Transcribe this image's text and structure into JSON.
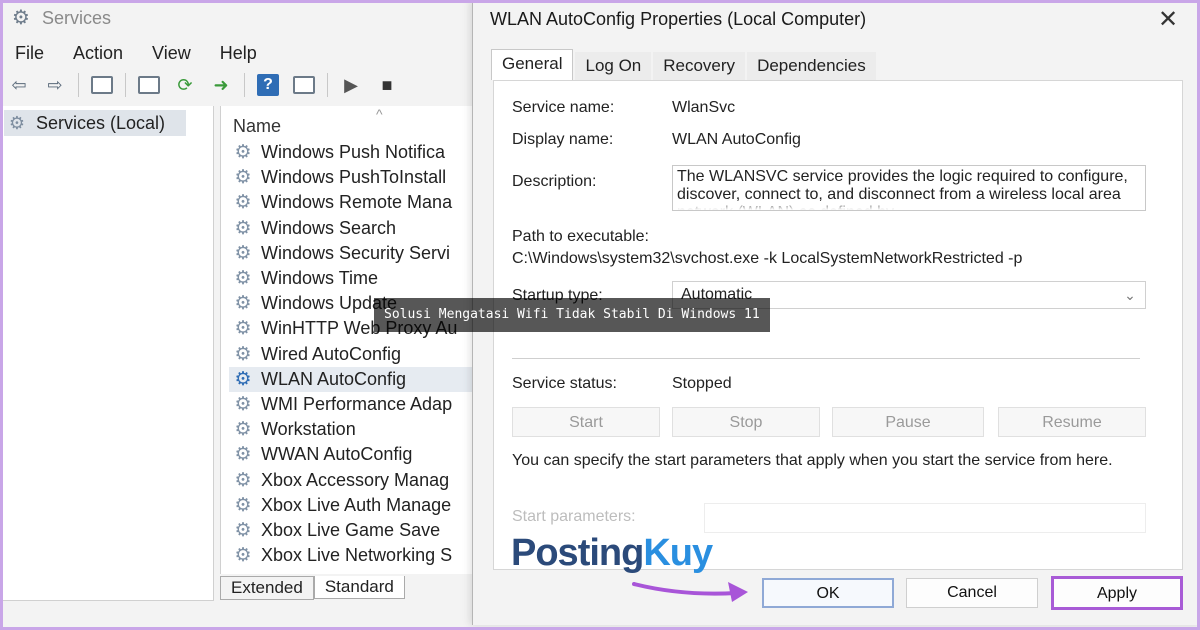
{
  "services_window": {
    "title": "Services",
    "menu": [
      "File",
      "Action",
      "View",
      "Help"
    ],
    "tree_item": "Services (Local)",
    "column_header": "Name",
    "rows": [
      "Windows Push Notifica",
      "Windows PushToInstall",
      "Windows Remote Mana",
      "Windows Search",
      "Windows Security Servi",
      "Windows Time",
      "Windows Update",
      "WinHTTP Web Proxy Au",
      "Wired AutoConfig",
      "WLAN AutoConfig",
      "WMI Performance Adap",
      "Workstation",
      "WWAN AutoConfig",
      "Xbox Accessory Manag",
      "Xbox Live Auth Manage",
      "Xbox Live Game Save",
      "Xbox Live Networking S"
    ],
    "selected_row": "WLAN AutoConfig",
    "bottom_tabs": [
      "Extended",
      "Standard"
    ]
  },
  "dialog": {
    "title": "WLAN AutoConfig Properties (Local Computer)",
    "tabs": [
      "General",
      "Log On",
      "Recovery",
      "Dependencies"
    ],
    "active_tab": "General",
    "service_name_label": "Service name:",
    "service_name": "WlanSvc",
    "display_name_label": "Display name:",
    "display_name": "WLAN AutoConfig",
    "description_label": "Description:",
    "description": "The WLANSVC service provides the logic required to configure, discover, connect to, and disconnect from a wireless local area network (WLAN) as defined by",
    "path_label": "Path to executable:",
    "path": "C:\\Windows\\system32\\svchost.exe -k LocalSystemNetworkRestricted -p",
    "startup_type_label": "Startup type:",
    "startup_type": "Automatic",
    "service_status_label": "Service status:",
    "service_status": "Stopped",
    "control_buttons": [
      "Start",
      "Stop",
      "Pause",
      "Resume"
    ],
    "help_text": "You can specify the start parameters that apply when you start the service from here.",
    "start_params_label": "Start parameters:",
    "ok_label": "OK",
    "cancel_label": "Cancel",
    "apply_label": "Apply"
  },
  "overlay": {
    "caption": "Solusi Mengatasi Wifi Tidak Stabil Di Windows 11",
    "brand_part1": "Posting",
    "brand_part2": "Kuy"
  },
  "colors": {
    "apply_highlight": "#a85bd6",
    "arrow": "#a855d8",
    "brand_dark": "#2b4a7a",
    "brand_light": "#2a8fe0"
  }
}
